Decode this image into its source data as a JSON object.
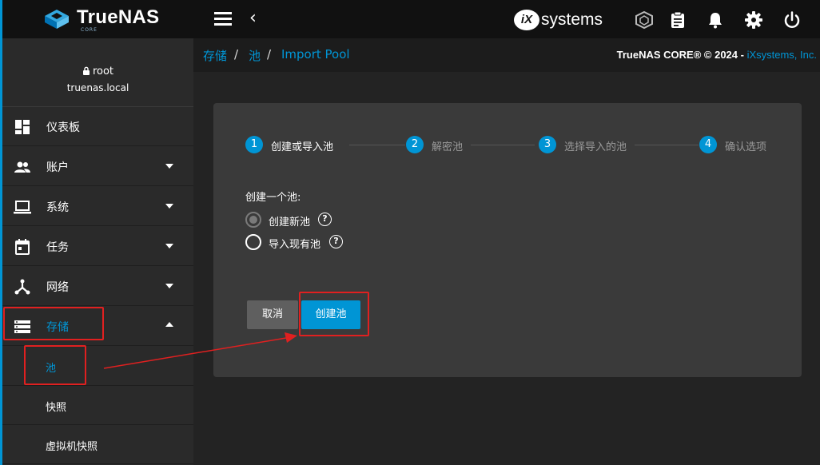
{
  "brand": {
    "name": "TrueNAS",
    "edition": "CORE"
  },
  "topbar": {
    "vendor_logo_text": "systems",
    "vendor_logo_mark": "iX"
  },
  "user": {
    "name": "root",
    "host": "truenas.local"
  },
  "sidebar": {
    "items": [
      {
        "label": "仪表板",
        "icon": "dashboard-icon"
      },
      {
        "label": "账户",
        "icon": "people-icon",
        "caret": "down"
      },
      {
        "label": "系统",
        "icon": "laptop-icon",
        "caret": "down"
      },
      {
        "label": "任务",
        "icon": "calendar-icon",
        "caret": "down"
      },
      {
        "label": "网络",
        "icon": "network-icon",
        "caret": "down"
      },
      {
        "label": "存储",
        "icon": "storage-icon",
        "caret": "up",
        "active": true
      }
    ],
    "sub_items": [
      {
        "label": "池",
        "active": true
      },
      {
        "label": "快照"
      },
      {
        "label": "虚拟机快照"
      }
    ]
  },
  "breadcrumb": {
    "items": [
      "存储",
      "池",
      "Import Pool"
    ],
    "separator": "/"
  },
  "copyright": {
    "text": "TrueNAS CORE® © 2024 - ",
    "link": "iXsystems, Inc."
  },
  "wizard": {
    "steps": [
      {
        "num": "1",
        "label": "创建或导入池",
        "active": true
      },
      {
        "num": "2",
        "label": "解密池"
      },
      {
        "num": "3",
        "label": "选择导入的池"
      },
      {
        "num": "4",
        "label": "确认选项"
      }
    ],
    "section_label": "创建一个池:",
    "options": [
      {
        "label": "创建新池",
        "checked": true
      },
      {
        "label": "导入现有池",
        "checked": false
      }
    ],
    "help_glyph": "?",
    "cancel_label": "取消",
    "create_label": "创建池"
  },
  "colors": {
    "accent": "#0095d5",
    "annotation": "#e02020",
    "card": "#3a3a3a",
    "sidebar": "#2a2a2a"
  }
}
